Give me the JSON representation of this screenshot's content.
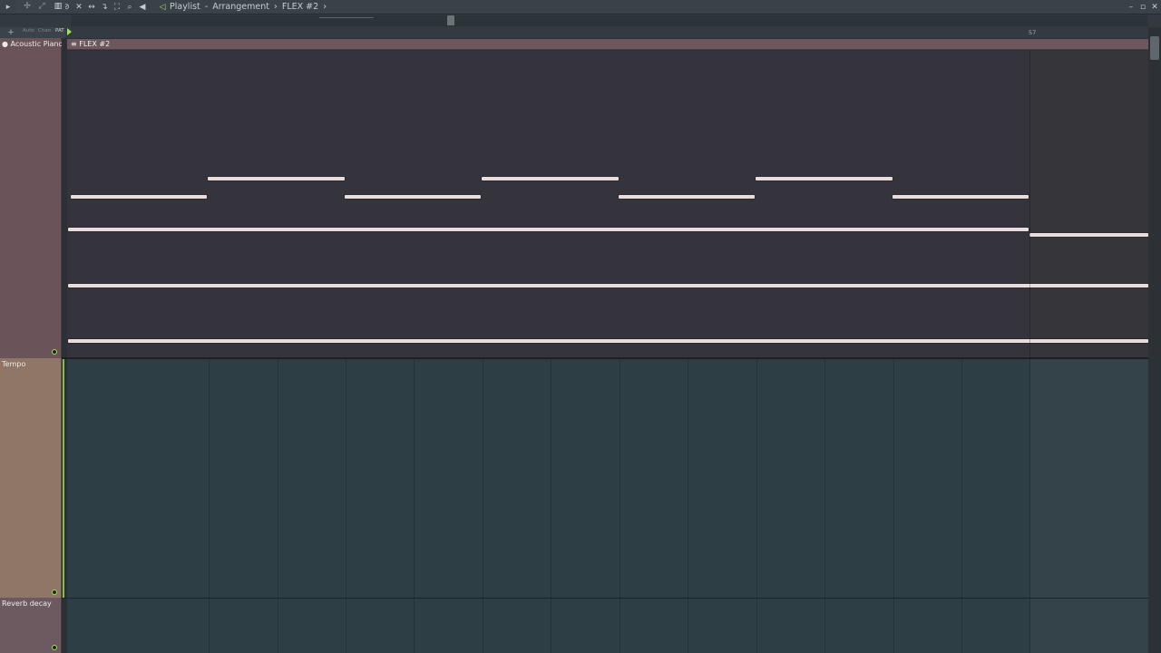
{
  "titlebar": {
    "breadcrumb": [
      "Playlist",
      "Arrangement",
      "FLEX #2"
    ],
    "separator": "-",
    "arrow": "›"
  },
  "toolbar": {
    "icons": [
      "play-menu-icon",
      "magnet-icon",
      "pencil-icon",
      "paint-icon",
      "delete-icon",
      "mute-icon",
      "slip-icon",
      "slice-icon",
      "select-icon",
      "zoom-icon",
      "playback-icon",
      "speaker-icon"
    ]
  },
  "subbar": {
    "labels": [
      "Auto",
      "Chan",
      "PAT"
    ]
  },
  "ruler": {
    "bar_label": "57"
  },
  "tracks": [
    {
      "label": "Acoustic Piano",
      "icon": "track-info-icon"
    },
    {
      "label": "Tempo"
    },
    {
      "label": "Reverb decay"
    }
  ],
  "clip": {
    "title": "FLEX #2",
    "icon": "clip-menu-icon"
  },
  "colors": {
    "accent_green": "#9fe05a",
    "note": "#e8dcdd",
    "piano_header": "#6b5459",
    "tempo_header": "#8f7666"
  }
}
